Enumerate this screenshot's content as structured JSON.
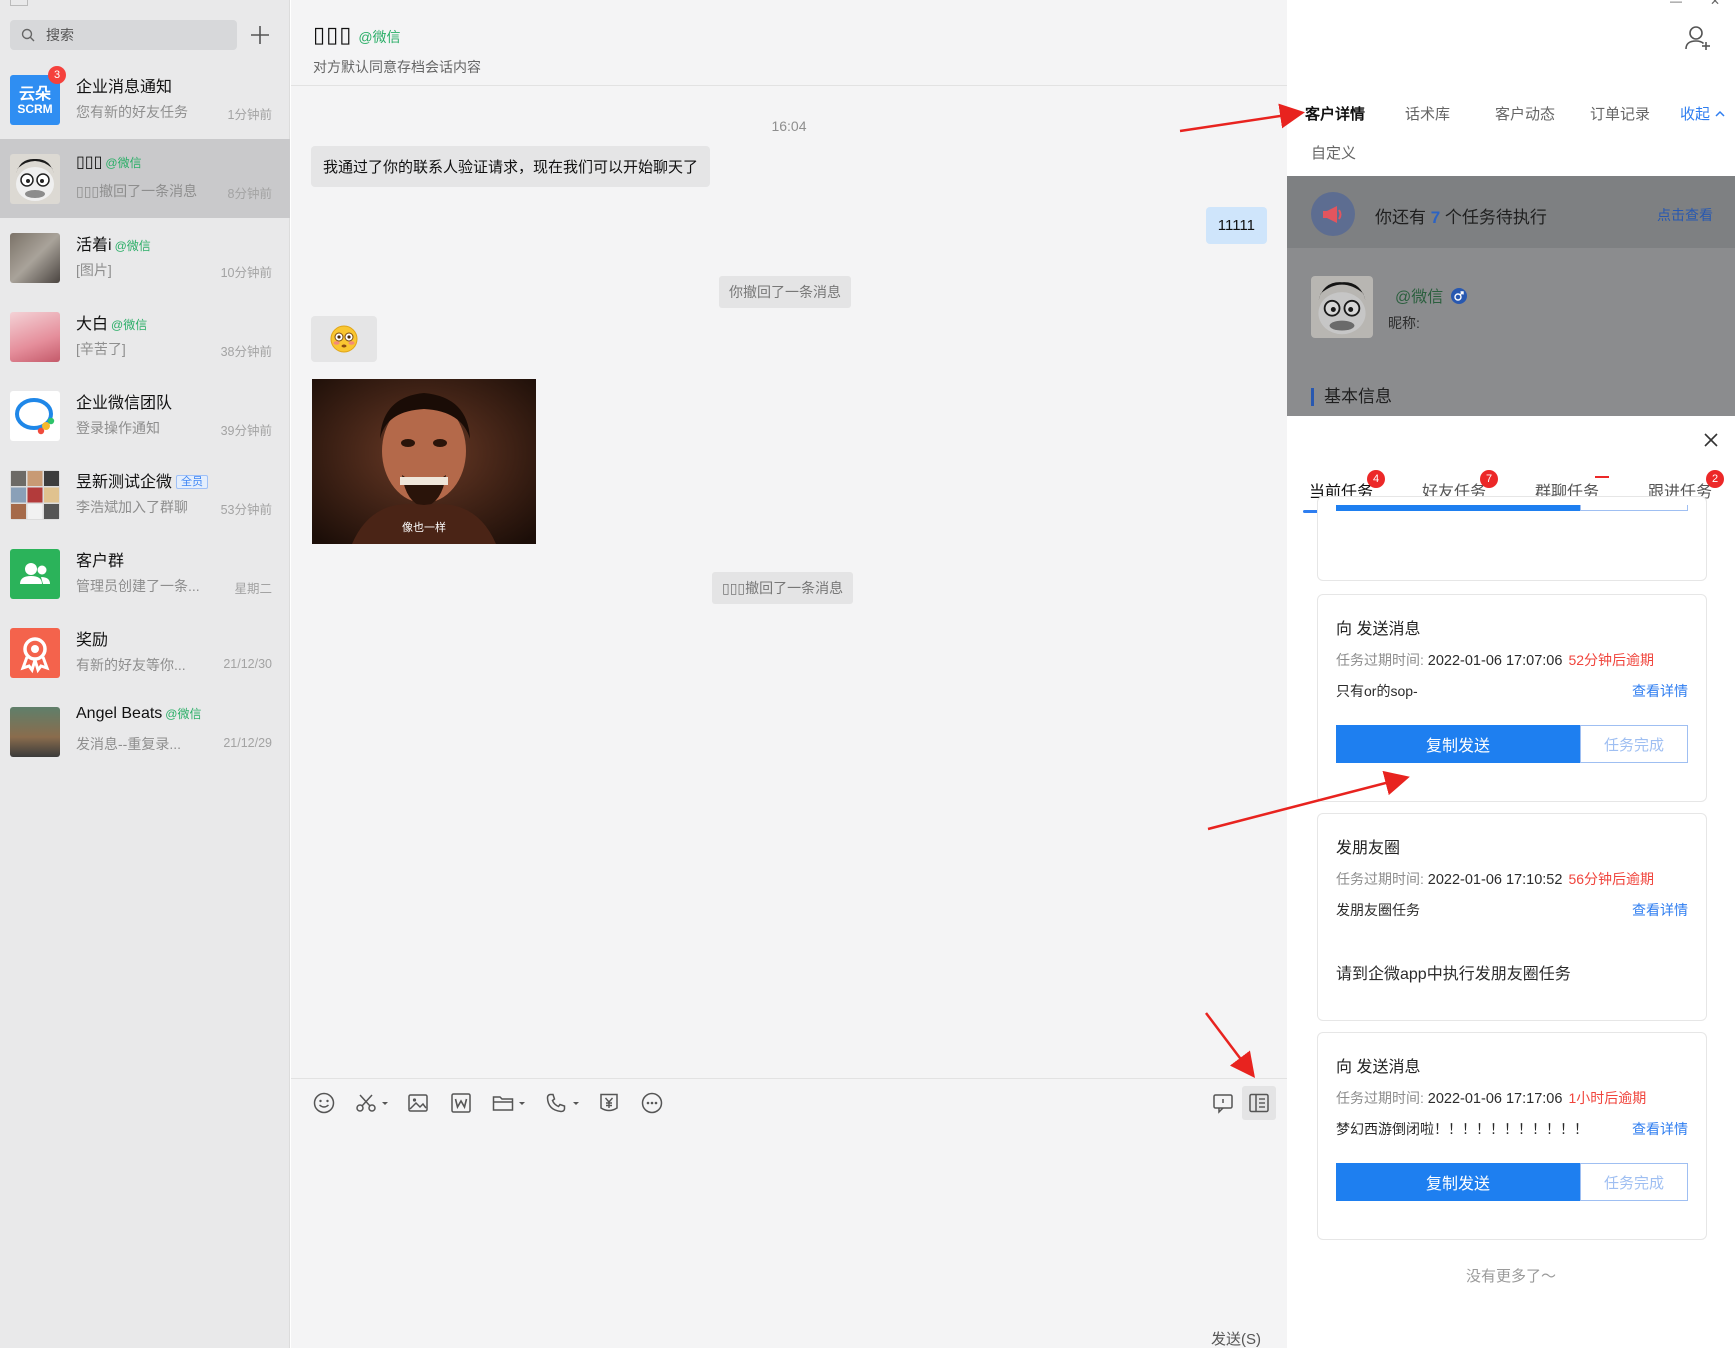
{
  "sidebar": {
    "search_placeholder": "搜索",
    "conversations": [
      {
        "name": "企业消息通知",
        "wx": "",
        "tag": "",
        "preview": "您有新的好友任务",
        "time": "1分钟前",
        "badge": "3"
      },
      {
        "name": "▯▯▯",
        "wx": "@微信",
        "tag": "",
        "preview": "▯▯▯撤回了一条消息",
        "time": "8分钟前",
        "badge": ""
      },
      {
        "name": "活着i",
        "wx": "@微信",
        "tag": "",
        "preview": "[图片]",
        "time": "10分钟前",
        "badge": ""
      },
      {
        "name": "大白",
        "wx": "@微信",
        "tag": "",
        "preview": "[辛苦了]",
        "time": "38分钟前",
        "badge": ""
      },
      {
        "name": "企业微信团队",
        "wx": "",
        "tag": "",
        "preview": "登录操作通知",
        "time": "39分钟前",
        "badge": ""
      },
      {
        "name": "昱新测试企微",
        "wx": "",
        "tag": "全员",
        "preview": "李浩斌加入了群聊",
        "time": "53分钟前",
        "badge": ""
      },
      {
        "name": "客户群",
        "wx": "",
        "tag": "",
        "preview": "管理员创建了一条...",
        "time": "星期二",
        "badge": ""
      },
      {
        "name": "奖励",
        "wx": "",
        "tag": "",
        "preview": "有新的好友等你...",
        "time": "21/12/30",
        "badge": ""
      },
      {
        "name": "Angel  Beats",
        "wx": "@微信",
        "tag": "",
        "preview": "发消息--重复录...",
        "time": "21/12/29",
        "badge": ""
      }
    ],
    "logo_text_top": "云朵",
    "logo_text_bottom": "SCRM"
  },
  "chat": {
    "title": "▯▯▯",
    "title_wx": "@微信",
    "subtitle": "对方默认同意存档会话内容",
    "timestamp": "16:04",
    "msg_verify": "我通过了你的联系人验证请求，现在我们可以开始聊天了",
    "msg_right": "11111",
    "sys_you_recalled": "你撤回了一条消息",
    "image_caption": "像也一样",
    "sys_other_recalled": "▯▯▯撤回了一条消息",
    "send_label": "发送(S)"
  },
  "right_panel": {
    "tabs": [
      "客户详情",
      "话术库",
      "客户动态",
      "订单记录"
    ],
    "collapse_label": "收起",
    "tab_custom": "自定义",
    "banner_prefix": "你还有 ",
    "banner_count": "7",
    "banner_suffix": " 个任务待执行",
    "banner_link": "点击查看",
    "profile_name": "@微信",
    "profile_nick": "昵称:",
    "basic_info": "基本信息"
  },
  "task_sheet": {
    "tabs": [
      {
        "label": "当前任务",
        "count": "4"
      },
      {
        "label": "好友任务",
        "count": "7"
      },
      {
        "label": "群聊任务",
        "count": ""
      },
      {
        "label": "跟进任务",
        "count": "2"
      }
    ],
    "meta_label": "任务过期时间:",
    "detail_link": "查看详情",
    "copy_send": "复制发送",
    "done": "任务完成",
    "cards": [
      {
        "title": "向  发送消息",
        "time": "2022-01-06 17:07:06",
        "due": "52分钟后逾期",
        "desc": "只有or的sop-"
      },
      {
        "title": "发朋友圈",
        "time": "2022-01-06 17:10:52",
        "due": "56分钟后逾期",
        "desc": "发朋友圈任务",
        "note": "请到企微app中执行发朋友圈任务"
      },
      {
        "title": "向  发送消息",
        "time": "2022-01-06 17:17:06",
        "due": "1小时后逾期",
        "desc": "梦幻西游倒闭啦！！！！！！！！！！！"
      }
    ],
    "no_more": "没有更多了～"
  },
  "colors": {
    "accent": "#1e7ff0",
    "overdue": "#f0443c",
    "wechat_green": "#2aae67",
    "annotation": "#e8231f"
  }
}
